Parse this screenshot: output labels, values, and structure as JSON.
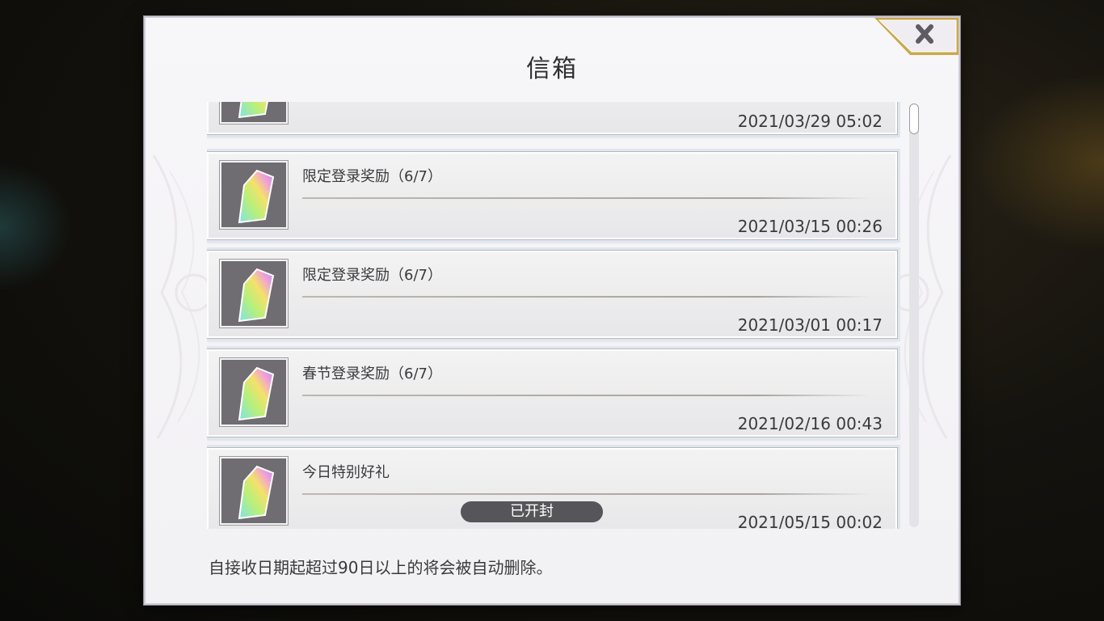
{
  "dialog": {
    "title": "信箱",
    "close_icon": "close-x-icon",
    "footer_note": "自接收日期起超过90日以上的将会被自动删除。"
  },
  "mails": [
    {
      "title": "",
      "date": "2021/03/29 05:02",
      "icon": "rainbow-crystal-icon",
      "opened": false
    },
    {
      "title": "限定登录奖励（6/7）",
      "date": "2021/03/15 00:26",
      "icon": "rainbow-crystal-icon",
      "opened": false
    },
    {
      "title": "限定登录奖励（6/7）",
      "date": "2021/03/01 00:17",
      "icon": "rainbow-crystal-icon",
      "opened": false
    },
    {
      "title": "春节登录奖励（6/7）",
      "date": "2021/02/16 00:43",
      "icon": "rainbow-crystal-icon",
      "opened": false
    },
    {
      "title": "今日特别好礼",
      "date": "2021/05/15 00:02",
      "icon": "rainbow-crystal-icon",
      "opened": true,
      "opened_label": "已开封"
    }
  ],
  "colors": {
    "accent_gold": "#c9a94a",
    "badge_bg": "#55555a",
    "panel_bg": "#f4f3f6"
  }
}
